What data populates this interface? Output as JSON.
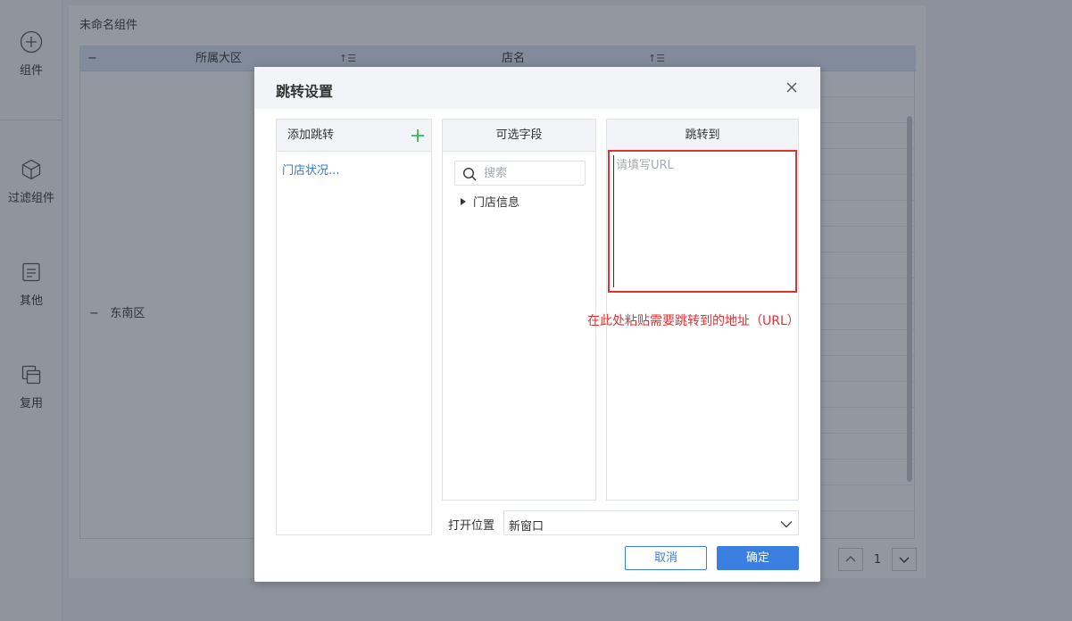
{
  "sidebar": {
    "items": [
      {
        "label": "组件",
        "icon": "add-circle-icon"
      },
      {
        "label": "过滤组件",
        "icon": "cube-icon"
      },
      {
        "label": "其他",
        "icon": "document-icon"
      },
      {
        "label": "复用",
        "icon": "copy-icon"
      }
    ]
  },
  "widget": {
    "title": "未命名组件",
    "table": {
      "collapse_symbol": "−",
      "columns": [
        "所属大区",
        "店名"
      ],
      "sort_icon": "sort-icon",
      "row_group": {
        "expand_symbol": "−",
        "label": "东南区"
      }
    },
    "pager": {
      "page": "1"
    }
  },
  "dialog": {
    "title": "跳转设置",
    "close_icon": "close-icon",
    "jump_panel": {
      "header": "添加跳转",
      "add_icon": "plus-icon",
      "items": [
        "门店状况..."
      ]
    },
    "fields_panel": {
      "header": "可选字段",
      "search_placeholder": "搜索",
      "tree": [
        {
          "label": "门店信息",
          "collapsed": true
        }
      ]
    },
    "target_panel": {
      "header": "跳转到",
      "url_placeholder": "请填写URL",
      "annotation": "在此处粘贴需要跳转到的地址（URL）"
    },
    "open_position": {
      "label": "打开位置",
      "value": "新窗口"
    },
    "buttons": {
      "cancel": "取消",
      "ok": "确定"
    }
  },
  "colors": {
    "accent": "#3a7ee0",
    "annotation_red": "#e03131",
    "add_green": "#2ebd59",
    "link_blue": "#2d7ad6",
    "table_header": "#dbe6f6"
  }
}
